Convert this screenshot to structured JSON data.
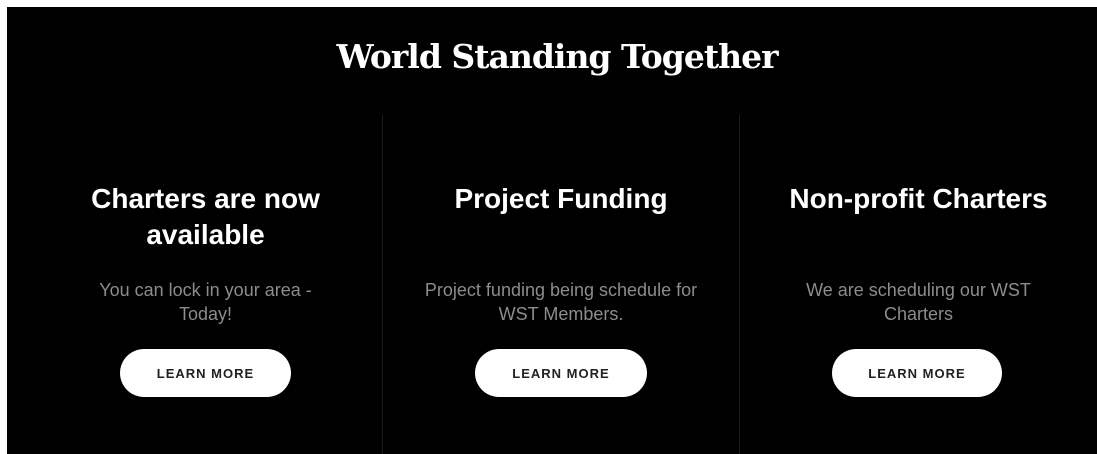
{
  "section": {
    "title": "World Standing Together"
  },
  "cards": [
    {
      "heading_line1": "Charters are now",
      "heading_line2": "available",
      "text": "You can lock in your area - Today!",
      "button_label": "LEARN MORE"
    },
    {
      "heading_line1": "Project Funding",
      "heading_line2": "",
      "text": "Project funding being schedule for WST Members.",
      "button_label": "LEARN MORE"
    },
    {
      "heading_line1": "Non-profit Charters",
      "heading_line2": "",
      "text": "We are scheduling our WST Charters",
      "button_label": "LEARN MORE"
    }
  ],
  "colors": {
    "background": "#000000",
    "heading": "#ffffff",
    "body_text": "#8c8c8c",
    "button_bg": "#ffffff",
    "button_text": "#222222"
  }
}
